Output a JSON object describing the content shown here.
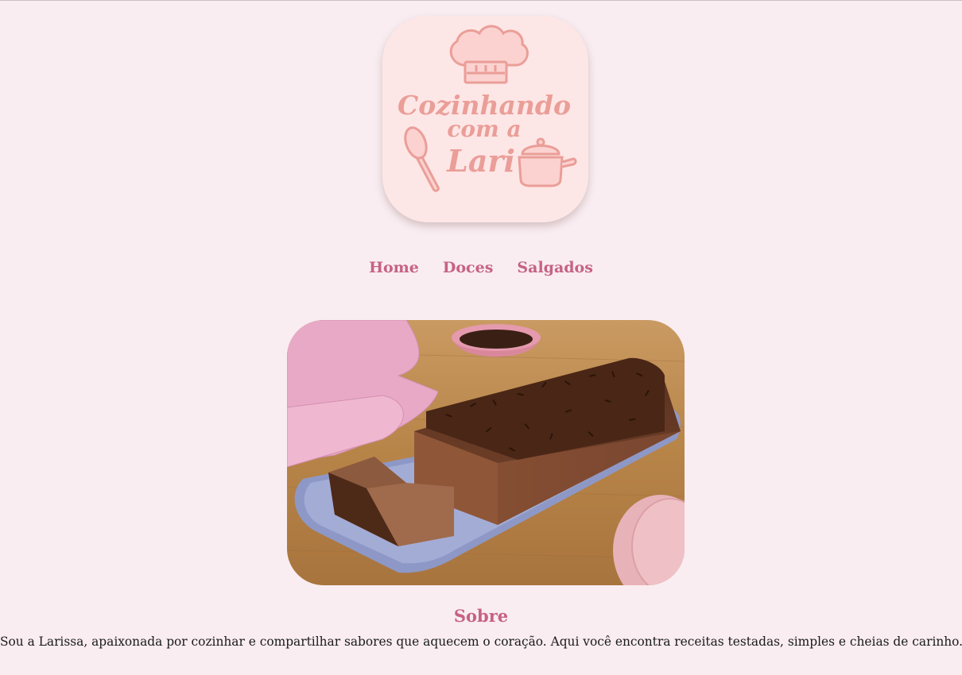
{
  "logo": {
    "line1": "Cozinhando",
    "line2": "com a",
    "line3": "Lari",
    "accent_color": "#ea9e98",
    "background_color": "#fde6e6"
  },
  "nav": {
    "items": [
      {
        "label": "Home"
      },
      {
        "label": "Doces"
      },
      {
        "label": "Salgados"
      }
    ],
    "color": "#c76284"
  },
  "hero": {
    "image": "chocolate-mousse-cake-photo"
  },
  "about": {
    "title": "Sobre",
    "text": "Sou a Larissa, apaixonada por cozinhar e compartilhar sabores que aquecem o coração. Aqui você encontra receitas testadas, simples e cheias de carinho."
  },
  "colors": {
    "page_background": "#f9edf1",
    "heading": "#c76284",
    "body_text": "#1a1a1a"
  }
}
